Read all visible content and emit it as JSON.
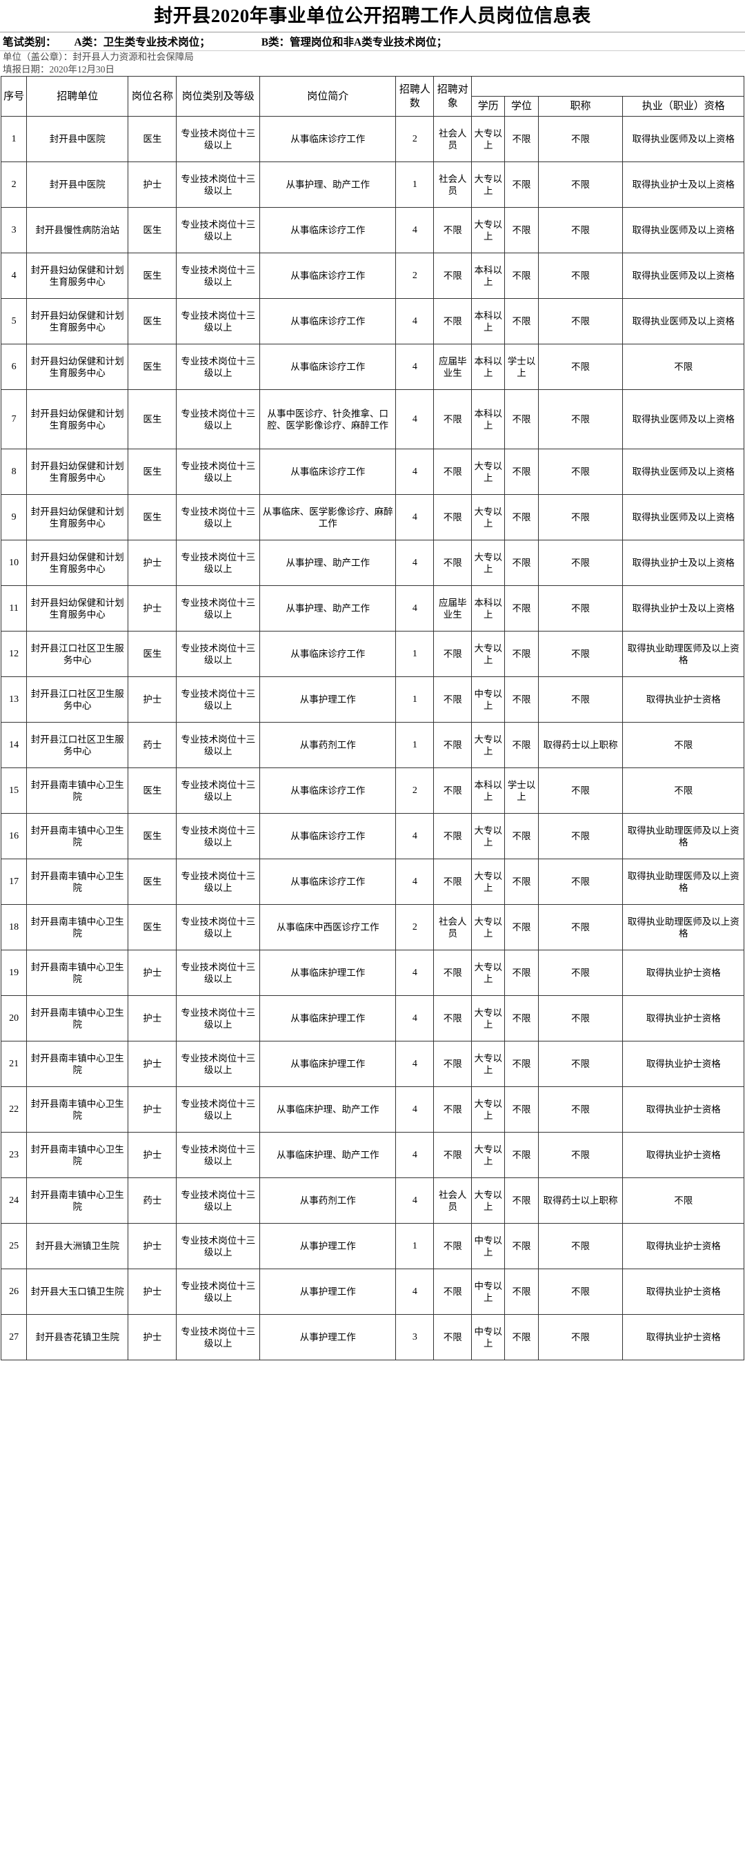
{
  "document": {
    "title": "封开县2020年事业单位公开招聘工作人员岗位信息表",
    "exam_category_label": "笔试类别：",
    "exam_category_a": "A类：卫生类专业技术岗位；",
    "exam_category_b": "B类：管理岗位和非A类专业技术岗位；",
    "unit_line": "单位（盖公章）：封开县人力资源和社会保障局",
    "date_line": "填报日期：2020年12月30日"
  },
  "table": {
    "headers": {
      "index": "序号",
      "unit": "招聘单位",
      "post_name": "岗位名称",
      "post_category": "岗位类别及等级",
      "post_desc": "岗位简介",
      "headcount": "招聘人数",
      "target": "招聘对象",
      "requirements_group": "",
      "education": "学历",
      "degree": "学位",
      "job_title": "职称",
      "qualification": "执业（职业）资格"
    },
    "rows": [
      {
        "index": "1",
        "unit": "封开县中医院",
        "post_name": "医生",
        "post_category": "专业技术岗位十三级以上",
        "post_desc": "从事临床诊疗工作",
        "headcount": "2",
        "target": "社会人员",
        "education": "大专以上",
        "degree": "不限",
        "job_title": "不限",
        "qualification": "取得执业医师及以上资格"
      },
      {
        "index": "2",
        "unit": "封开县中医院",
        "post_name": "护士",
        "post_category": "专业技术岗位十三级以上",
        "post_desc": "从事护理、助产工作",
        "headcount": "1",
        "target": "社会人员",
        "education": "大专以上",
        "degree": "不限",
        "job_title": "不限",
        "qualification": "取得执业护士及以上资格"
      },
      {
        "index": "3",
        "unit": "封开县慢性病防治站",
        "post_name": "医生",
        "post_category": "专业技术岗位十三级以上",
        "post_desc": "从事临床诊疗工作",
        "headcount": "4",
        "target": "不限",
        "education": "大专以上",
        "degree": "不限",
        "job_title": "不限",
        "qualification": "取得执业医师及以上资格"
      },
      {
        "index": "4",
        "unit": "封开县妇幼保健和计划生育服务中心",
        "post_name": "医生",
        "post_category": "专业技术岗位十三级以上",
        "post_desc": "从事临床诊疗工作",
        "headcount": "2",
        "target": "不限",
        "education": "本科以上",
        "degree": "不限",
        "job_title": "不限",
        "qualification": "取得执业医师及以上资格"
      },
      {
        "index": "5",
        "unit": "封开县妇幼保健和计划生育服务中心",
        "post_name": "医生",
        "post_category": "专业技术岗位十三级以上",
        "post_desc": "从事临床诊疗工作",
        "headcount": "4",
        "target": "不限",
        "education": "本科以上",
        "degree": "不限",
        "job_title": "不限",
        "qualification": "取得执业医师及以上资格"
      },
      {
        "index": "6",
        "unit": "封开县妇幼保健和计划生育服务中心",
        "post_name": "医生",
        "post_category": "专业技术岗位十三级以上",
        "post_desc": "从事临床诊疗工作",
        "headcount": "4",
        "target": "应届毕业生",
        "education": "本科以上",
        "degree": "学士以上",
        "job_title": "不限",
        "qualification": "不限"
      },
      {
        "index": "7",
        "unit": "封开县妇幼保健和计划生育服务中心",
        "post_name": "医生",
        "post_category": "专业技术岗位十三级以上",
        "post_desc": "从事中医诊疗、针灸推拿、口腔、医学影像诊疗、麻醉工作",
        "headcount": "4",
        "target": "不限",
        "education": "本科以上",
        "degree": "不限",
        "job_title": "不限",
        "qualification": "取得执业医师及以上资格"
      },
      {
        "index": "8",
        "unit": "封开县妇幼保健和计划生育服务中心",
        "post_name": "医生",
        "post_category": "专业技术岗位十三级以上",
        "post_desc": "从事临床诊疗工作",
        "headcount": "4",
        "target": "不限",
        "education": "大专以上",
        "degree": "不限",
        "job_title": "不限",
        "qualification": "取得执业医师及以上资格"
      },
      {
        "index": "9",
        "unit": "封开县妇幼保健和计划生育服务中心",
        "post_name": "医生",
        "post_category": "专业技术岗位十三级以上",
        "post_desc": "从事临床、医学影像诊疗、麻醉工作",
        "headcount": "4",
        "target": "不限",
        "education": "大专以上",
        "degree": "不限",
        "job_title": "不限",
        "qualification": "取得执业医师及以上资格"
      },
      {
        "index": "10",
        "unit": "封开县妇幼保健和计划生育服务中心",
        "post_name": "护士",
        "post_category": "专业技术岗位十三级以上",
        "post_desc": "从事护理、助产工作",
        "headcount": "4",
        "target": "不限",
        "education": "大专以上",
        "degree": "不限",
        "job_title": "不限",
        "qualification": "取得执业护士及以上资格"
      },
      {
        "index": "11",
        "unit": "封开县妇幼保健和计划生育服务中心",
        "post_name": "护士",
        "post_category": "专业技术岗位十三级以上",
        "post_desc": "从事护理、助产工作",
        "headcount": "4",
        "target": "应届毕业生",
        "education": "本科以上",
        "degree": "不限",
        "job_title": "不限",
        "qualification": "取得执业护士及以上资格"
      },
      {
        "index": "12",
        "unit": "封开县江口社区卫生服务中心",
        "post_name": "医生",
        "post_category": "专业技术岗位十三级以上",
        "post_desc": "从事临床诊疗工作",
        "headcount": "1",
        "target": "不限",
        "education": "大专以上",
        "degree": "不限",
        "job_title": "不限",
        "qualification": "取得执业助理医师及以上资格"
      },
      {
        "index": "13",
        "unit": "封开县江口社区卫生服务中心",
        "post_name": "护士",
        "post_category": "专业技术岗位十三级以上",
        "post_desc": "从事护理工作",
        "headcount": "1",
        "target": "不限",
        "education": "中专以上",
        "degree": "不限",
        "job_title": "不限",
        "qualification": "取得执业护士资格"
      },
      {
        "index": "14",
        "unit": "封开县江口社区卫生服务中心",
        "post_name": "药士",
        "post_category": "专业技术岗位十三级以上",
        "post_desc": "从事药剂工作",
        "headcount": "1",
        "target": "不限",
        "education": "大专以上",
        "degree": "不限",
        "job_title": "取得药士以上职称",
        "qualification": "不限"
      },
      {
        "index": "15",
        "unit": "封开县南丰镇中心卫生院",
        "post_name": "医生",
        "post_category": "专业技术岗位十三级以上",
        "post_desc": "从事临床诊疗工作",
        "headcount": "2",
        "target": "不限",
        "education": "本科以上",
        "degree": "学士以上",
        "job_title": "不限",
        "qualification": "不限"
      },
      {
        "index": "16",
        "unit": "封开县南丰镇中心卫生院",
        "post_name": "医生",
        "post_category": "专业技术岗位十三级以上",
        "post_desc": "从事临床诊疗工作",
        "headcount": "4",
        "target": "不限",
        "education": "大专以上",
        "degree": "不限",
        "job_title": "不限",
        "qualification": "取得执业助理医师及以上资格"
      },
      {
        "index": "17",
        "unit": "封开县南丰镇中心卫生院",
        "post_name": "医生",
        "post_category": "专业技术岗位十三级以上",
        "post_desc": "从事临床诊疗工作",
        "headcount": "4",
        "target": "不限",
        "education": "大专以上",
        "degree": "不限",
        "job_title": "不限",
        "qualification": "取得执业助理医师及以上资格"
      },
      {
        "index": "18",
        "unit": "封开县南丰镇中心卫生院",
        "post_name": "医生",
        "post_category": "专业技术岗位十三级以上",
        "post_desc": "从事临床中西医诊疗工作",
        "headcount": "2",
        "target": "社会人员",
        "education": "大专以上",
        "degree": "不限",
        "job_title": "不限",
        "qualification": "取得执业助理医师及以上资格"
      },
      {
        "index": "19",
        "unit": "封开县南丰镇中心卫生院",
        "post_name": "护士",
        "post_category": "专业技术岗位十三级以上",
        "post_desc": "从事临床护理工作",
        "headcount": "4",
        "target": "不限",
        "education": "大专以上",
        "degree": "不限",
        "job_title": "不限",
        "qualification": "取得执业护士资格"
      },
      {
        "index": "20",
        "unit": "封开县南丰镇中心卫生院",
        "post_name": "护士",
        "post_category": "专业技术岗位十三级以上",
        "post_desc": "从事临床护理工作",
        "headcount": "4",
        "target": "不限",
        "education": "大专以上",
        "degree": "不限",
        "job_title": "不限",
        "qualification": "取得执业护士资格"
      },
      {
        "index": "21",
        "unit": "封开县南丰镇中心卫生院",
        "post_name": "护士",
        "post_category": "专业技术岗位十三级以上",
        "post_desc": "从事临床护理工作",
        "headcount": "4",
        "target": "不限",
        "education": "大专以上",
        "degree": "不限",
        "job_title": "不限",
        "qualification": "取得执业护士资格"
      },
      {
        "index": "22",
        "unit": "封开县南丰镇中心卫生院",
        "post_name": "护士",
        "post_category": "专业技术岗位十三级以上",
        "post_desc": "从事临床护理、助产工作",
        "headcount": "4",
        "target": "不限",
        "education": "大专以上",
        "degree": "不限",
        "job_title": "不限",
        "qualification": "取得执业护士资格"
      },
      {
        "index": "23",
        "unit": "封开县南丰镇中心卫生院",
        "post_name": "护士",
        "post_category": "专业技术岗位十三级以上",
        "post_desc": "从事临床护理、助产工作",
        "headcount": "4",
        "target": "不限",
        "education": "大专以上",
        "degree": "不限",
        "job_title": "不限",
        "qualification": "取得执业护士资格"
      },
      {
        "index": "24",
        "unit": "封开县南丰镇中心卫生院",
        "post_name": "药士",
        "post_category": "专业技术岗位十三级以上",
        "post_desc": "从事药剂工作",
        "headcount": "4",
        "target": "社会人员",
        "education": "大专以上",
        "degree": "不限",
        "job_title": "取得药士以上职称",
        "qualification": "不限"
      },
      {
        "index": "25",
        "unit": "封开县大洲镇卫生院",
        "post_name": "护士",
        "post_category": "专业技术岗位十三级以上",
        "post_desc": "从事护理工作",
        "headcount": "1",
        "target": "不限",
        "education": "中专以上",
        "degree": "不限",
        "job_title": "不限",
        "qualification": "取得执业护士资格"
      },
      {
        "index": "26",
        "unit": "封开县大玉口镇卫生院",
        "post_name": "护士",
        "post_category": "专业技术岗位十三级以上",
        "post_desc": "从事护理工作",
        "headcount": "4",
        "target": "不限",
        "education": "中专以上",
        "degree": "不限",
        "job_title": "不限",
        "qualification": "取得执业护士资格"
      },
      {
        "index": "27",
        "unit": "封开县杏花镇卫生院",
        "post_name": "护士",
        "post_category": "专业技术岗位十三级以上",
        "post_desc": "从事护理工作",
        "headcount": "3",
        "target": "不限",
        "education": "中专以上",
        "degree": "不限",
        "job_title": "不限",
        "qualification": "取得执业护士资格"
      }
    ]
  }
}
